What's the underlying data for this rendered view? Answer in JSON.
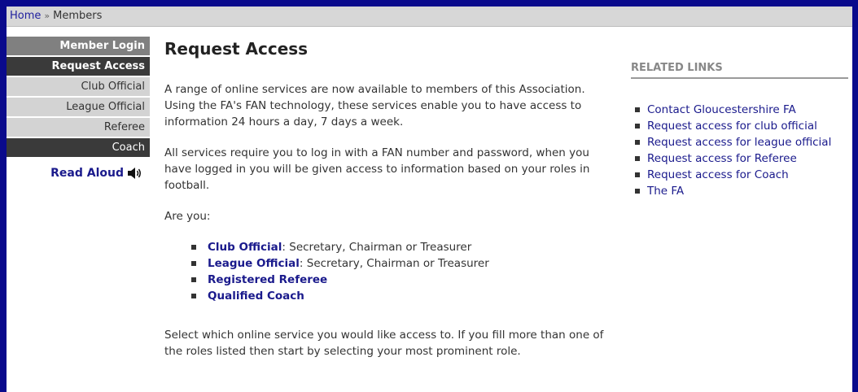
{
  "breadcrumb": {
    "home": "Home",
    "separator": "»",
    "current": "Members"
  },
  "sidebar": {
    "items": [
      {
        "label": "Member Login"
      },
      {
        "label": "Request Access"
      },
      {
        "label": "Club Official"
      },
      {
        "label": "League Official"
      },
      {
        "label": "Referee"
      },
      {
        "label": "Coach"
      }
    ],
    "read_aloud": "Read Aloud"
  },
  "main": {
    "title": "Request Access",
    "para1": "A range of online services are now available to members of this Association. Using the FA's FAN technology, these services enable you to have access to information 24 hours a day, 7 days a week.",
    "para2": "All services require you to log in with a FAN number and password, when you have logged in you will be given access to information based on your roles in football.",
    "question": "Are you:",
    "roles": [
      {
        "link": "Club Official",
        "detail": ": Secretary, Chairman or Treasurer"
      },
      {
        "link": "League Official",
        "detail": ": Secretary, Chairman or Treasurer"
      },
      {
        "link": "Registered Referee",
        "detail": ""
      },
      {
        "link": "Qualified Coach",
        "detail": ""
      }
    ],
    "para3": "Select which online service you would like access to. If you fill more than one of the roles listed then start by selecting your most prominent role."
  },
  "related": {
    "heading": "RELATED LINKS",
    "links": [
      "Contact Gloucestershire FA",
      "Request access for club official",
      "Request access for league official",
      "Request access for Referee",
      "Request access for Coach",
      "The FA"
    ]
  }
}
